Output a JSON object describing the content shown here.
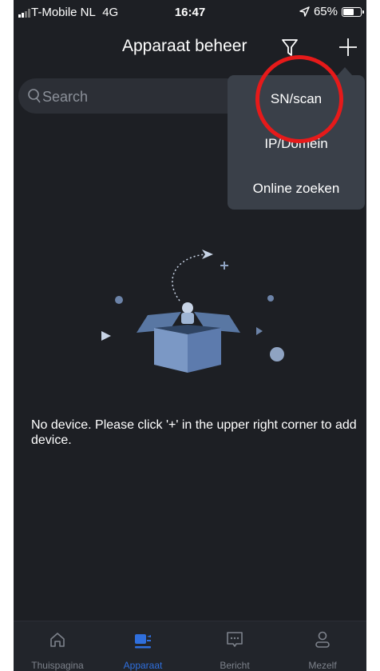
{
  "status_bar": {
    "carrier": "T-Mobile NL",
    "network": "4G",
    "time": "16:47",
    "battery": "65%",
    "battery_level": 0.65
  },
  "header": {
    "title": "Apparaat beheer",
    "filter_icon": "filter-icon",
    "add_icon": "plus-icon"
  },
  "search": {
    "placeholder": "Search",
    "icon": "search-icon"
  },
  "add_menu": {
    "items": [
      {
        "label": "SN/scan"
      },
      {
        "label": "IP/Domein"
      },
      {
        "label": "Online zoeken"
      }
    ]
  },
  "empty_state": {
    "illustration": "open-box-icon",
    "message": "No device. Please click '+' in the upper right corner to add device."
  },
  "tab_bar": {
    "tabs": [
      {
        "label": "Thuispagina",
        "icon": "home-icon",
        "active": false
      },
      {
        "label": "Apparaat",
        "icon": "camera-icon",
        "active": true
      },
      {
        "label": "Bericht",
        "icon": "message-icon",
        "active": false
      },
      {
        "label": "Mezelf",
        "icon": "user-icon",
        "active": false
      }
    ]
  },
  "colors": {
    "background": "#1d1f24",
    "accent": "#2f6fdd",
    "menu": "#3a4049",
    "highlight_circle": "#e61a1a"
  }
}
